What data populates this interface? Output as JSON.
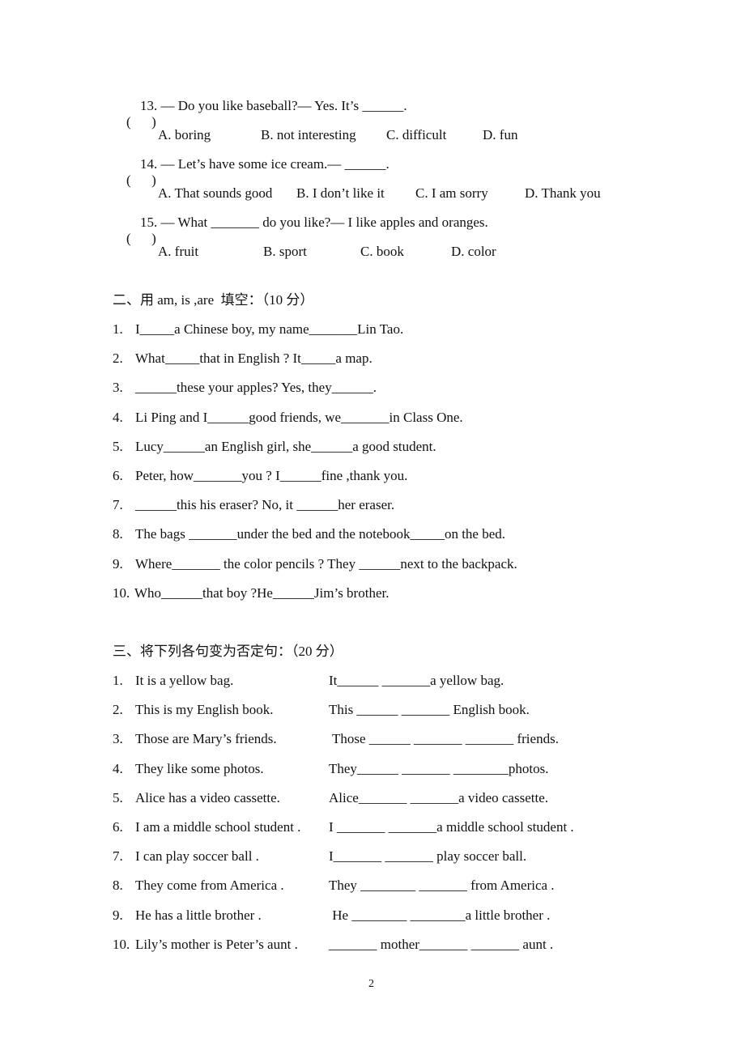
{
  "section1": {
    "questions": [
      {
        "paren": "(      )",
        "stem": "13. — Do you like baseball?— Yes. It’s ______.",
        "options": [
          "A. boring",
          "B. not interesting",
          "C. difficult",
          "D. fun"
        ]
      },
      {
        "paren": "(      )",
        "stem": "14. — Let’s have some ice cream.— ______.",
        "options": [
          "A. That sounds good",
          "B. I don’t like it",
          "C. I am sorry",
          "D. Thank you"
        ]
      },
      {
        "paren": "(      )",
        "stem": "15. — What _______ do you like?— I like apples and oranges.",
        "options": [
          "A. fruit",
          "B. sport",
          "C. book",
          "D. color"
        ]
      }
    ]
  },
  "section2": {
    "heading": "二、用 am, is ,are  填空：（10 分）",
    "items": [
      {
        "num": "1.",
        "text": "I_____a Chinese boy, my name_______Lin Tao."
      },
      {
        "num": "2.",
        "text": "What_____that in English ? It_____a map."
      },
      {
        "num": "3.",
        "text": "______these your apples? Yes, they______."
      },
      {
        "num": "4.",
        "text": "Li Ping and I______good friends, we_______in Class One."
      },
      {
        "num": "5.",
        "text": "Lucy______an English girl, she______a good student."
      },
      {
        "num": "6.",
        "text": "Peter, how_______you ? I______fine ,thank you."
      },
      {
        "num": "7.",
        "text": "______this his eraser? No, it ______her eraser."
      },
      {
        "num": "8.",
        "text": "The bags _______under the bed and the notebook_____on the bed."
      },
      {
        "num": "9.",
        "text": "Where_______ the color pencils ? They ______next to the backpack."
      },
      {
        "num": "10.",
        "text": "Who______that boy ?He______Jim’s brother."
      }
    ]
  },
  "section3": {
    "heading": "三、将下列各句变为否定句：（20 分）",
    "items": [
      {
        "num": "1.",
        "original": "It is a yellow bag.",
        "answer": "It______ _______a yellow bag."
      },
      {
        "num": "2.",
        "original": "This is my English book.",
        "answer": "This ______ _______ English book."
      },
      {
        "num": "3.",
        "original": "Those are Mary’s friends.",
        "answer": " Those ______ _______ _______ friends."
      },
      {
        "num": "4.",
        "original": "They like some photos.",
        "answer": "They______ _______ ________photos."
      },
      {
        "num": "5.",
        "original": "Alice has a video cassette.",
        "answer": "Alice_______ _______a video cassette."
      },
      {
        "num": "6.",
        "original": "I am a middle school student .",
        "answer": "I _______ _______a middle school student ."
      },
      {
        "num": "7.",
        "original": "I can play soccer ball .",
        "answer": "I_______ _______ play soccer ball."
      },
      {
        "num": "8.",
        "original": "They come from America .",
        "answer": "They ________ _______ from America ."
      },
      {
        "num": "9.",
        "original": "He has a little brother .",
        "answer": " He ________ ________a little brother ."
      },
      {
        "num": "10.",
        "original": "Lily’s mother is Peter’s aunt .",
        "answer": "_______ mother_______ _______ aunt ."
      }
    ]
  },
  "page_number": "2"
}
